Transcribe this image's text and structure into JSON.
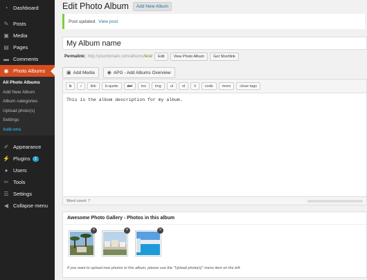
{
  "sidebar": {
    "items": [
      {
        "label": "Dashboard",
        "icon": "dashboard-icon"
      },
      {
        "label": "Posts",
        "icon": "pin-icon"
      },
      {
        "label": "Media",
        "icon": "media-icon"
      },
      {
        "label": "Pages",
        "icon": "page-icon"
      },
      {
        "label": "Comments",
        "icon": "comment-icon"
      },
      {
        "label": "Photo Albums",
        "icon": "camera-icon"
      }
    ],
    "submenu": [
      "All Photo Albums",
      "Add New Album",
      "Album categories",
      "Upload photo(s)",
      "Settings",
      "Add-ons"
    ],
    "items2": [
      {
        "label": "Appearance",
        "icon": "brush-icon"
      },
      {
        "label": "Plugins",
        "icon": "plug-icon",
        "badge": "1"
      },
      {
        "label": "Users",
        "icon": "user-icon"
      },
      {
        "label": "Tools",
        "icon": "wrench-icon"
      },
      {
        "label": "Settings",
        "icon": "settings-icon"
      },
      {
        "label": "Collapse menu",
        "icon": "collapse-icon"
      }
    ]
  },
  "header": {
    "title": "Edit Photo Album",
    "add_new": "Add New Album"
  },
  "notice": {
    "text": "Post updated.",
    "link": "View post"
  },
  "post": {
    "title": "My Album name"
  },
  "permalink": {
    "label": "Permalink:",
    "url": "http://yourdomain.com/albums/",
    "slug": "test",
    "suffix": "/",
    "buttons": [
      "Edit",
      "View Photo Album",
      "Get Shortlink"
    ]
  },
  "media": {
    "add_media": "Add Media",
    "apg_button": "APG - Add Albums Overview"
  },
  "quicktags": [
    "b",
    "i",
    "link",
    "b-quote",
    "del",
    "ins",
    "img",
    "ul",
    "ol",
    "li",
    "code",
    "more",
    "close tags"
  ],
  "editor": {
    "content": "This is the album description for my album."
  },
  "wordcount": {
    "text": "Word count: 7"
  },
  "gallery": {
    "title": "Awesome Photo Gallery - Photos in this album",
    "hint": "If you want to upload new photos to this album, please use the \"Upload photo(s)\" menu item on the left.",
    "remove_symbol": "×"
  },
  "colors": {
    "active_menu": "#d54e21",
    "sidebar_bg": "#222222",
    "link": "#21759b",
    "notice_border": "#7ad03a"
  }
}
